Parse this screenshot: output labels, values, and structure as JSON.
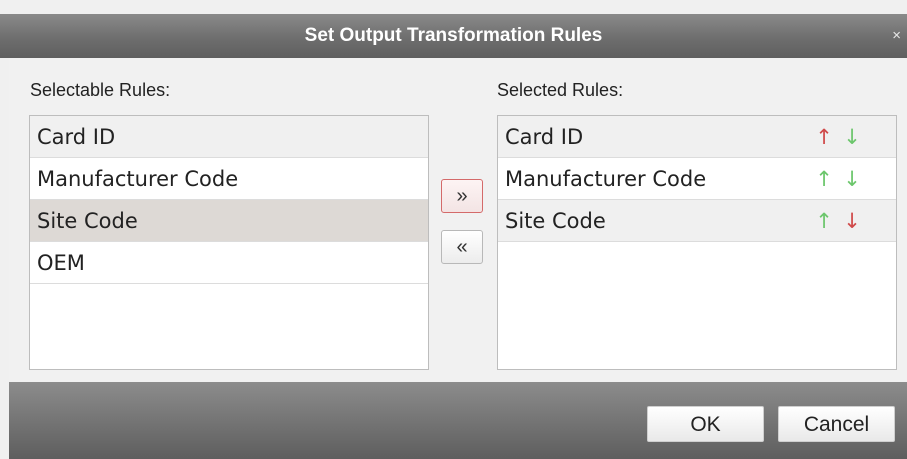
{
  "dialog": {
    "title": "Set Output Transformation Rules",
    "close_glyph": "×"
  },
  "selectable": {
    "label": "Selectable Rules:",
    "items": [
      "Card ID",
      "Manufacturer Code",
      "Site Code",
      "OEM"
    ],
    "selected_item": "Site Code"
  },
  "selected": {
    "label": "Selected Rules:",
    "items": [
      {
        "label": "Card ID",
        "up": "↑",
        "down": "↓",
        "up_color": "#d04a4a",
        "down_color": "#6cc66c"
      },
      {
        "label": "Manufacturer Code",
        "up": "↑",
        "down": "↓",
        "up_color": "#6cc66c",
        "down_color": "#6cc66c"
      },
      {
        "label": "Site Code",
        "up": "↑",
        "down": "↓",
        "up_color": "#6cc66c",
        "down_color": "#d04a4a"
      }
    ]
  },
  "move": {
    "add_glyph": "»",
    "remove_glyph": "«"
  },
  "buttons": {
    "ok": "OK",
    "cancel": "Cancel"
  },
  "icons": {
    "close": "close-icon",
    "move_right": "double-chevron-right-icon",
    "move_left": "double-chevron-left-icon",
    "up": "arrow-up-icon",
    "down": "arrow-down-icon"
  }
}
